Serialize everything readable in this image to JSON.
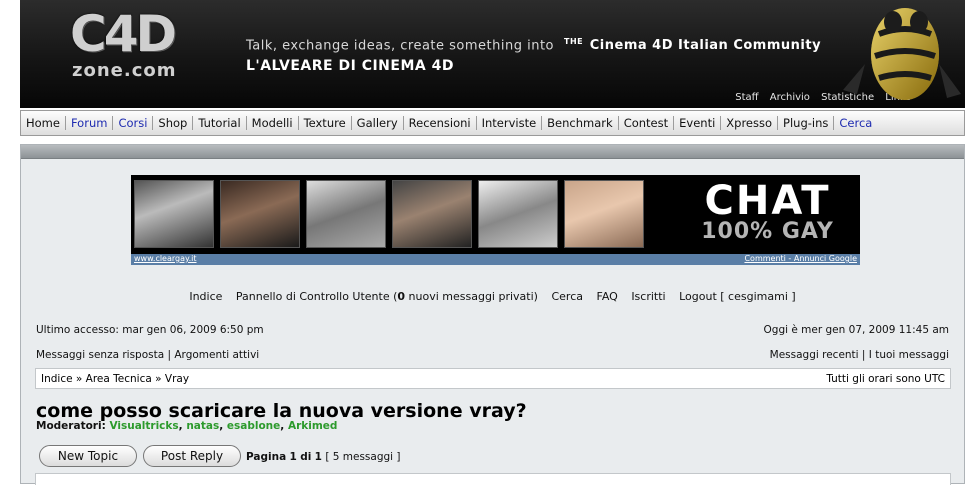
{
  "header": {
    "logo_main": "C4D",
    "logo_sub": "zone.com",
    "tagline": "Talk, exchange ideas, create something into",
    "tagline_the": "THE",
    "tagline_community": "Cinema 4D Italian Community",
    "subtitle": "L'ALVEARE DI CINEMA 4D",
    "links": [
      "Staff",
      "Archivio",
      "Statistiche",
      "Links"
    ]
  },
  "nav": {
    "items": [
      {
        "label": "Home"
      },
      {
        "label": "Forum"
      },
      {
        "label": "Corsi"
      },
      {
        "label": "Shop"
      },
      {
        "label": "Tutorial"
      },
      {
        "label": "Modelli"
      },
      {
        "label": "Texture"
      },
      {
        "label": "Gallery"
      },
      {
        "label": "Recensioni"
      },
      {
        "label": "Interviste"
      },
      {
        "label": "Benchmark"
      },
      {
        "label": "Contest"
      },
      {
        "label": "Eventi"
      },
      {
        "label": "Xpresso"
      },
      {
        "label": "Plug-ins"
      },
      {
        "label": "Cerca"
      }
    ]
  },
  "ad": {
    "headline": "CHAT",
    "subline": "100% GAY",
    "source": "www.cleargay.it",
    "google": "Commenti - Annunci Google"
  },
  "usermenu": {
    "indice": "Indice",
    "pannello_prefix": "Pannello di Controllo Utente (",
    "pannello_count": "0",
    "pannello_suffix": " nuovi messaggi privati)",
    "cerca": "Cerca",
    "faq": "FAQ",
    "iscritti": "Iscritti",
    "logout": "Logout [ cesgimami ]"
  },
  "info": {
    "last_access": "Ultimo accesso: mar gen 06, 2009 6:50 pm",
    "today": "Oggi è mer gen 07, 2009 11:45 am",
    "unanswered": "Messaggi senza risposta | Argomenti attivi",
    "recent": "Messaggi recenti | I tuoi messaggi"
  },
  "breadcrumb": {
    "path": "Indice » Area Tecnica » Vray",
    "timezone": "Tutti gli orari sono UTC"
  },
  "topic": {
    "title": "come posso scaricare la nuova versione vray?",
    "moderators_label": "Moderatori:",
    "moderators": [
      "Visualtricks",
      "natas",
      "esablone",
      "Arkimed"
    ]
  },
  "buttons": {
    "new_topic": "New Topic",
    "post_reply": "Post Reply"
  },
  "pager": {
    "page_label": "Pagina",
    "current": "1",
    "of_label": "di",
    "total": "1",
    "messages": "[ 5 messaggi ]"
  },
  "colors": {
    "header_bg": "#111111",
    "panel_bg": "#e9ecee",
    "nav_highlight": "#1e2bb0",
    "moderator_green": "#2c9a2c",
    "ad_bar": "#5a7ea6"
  }
}
